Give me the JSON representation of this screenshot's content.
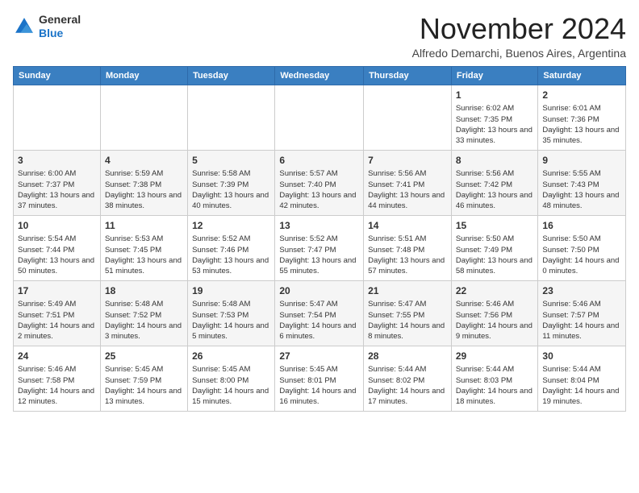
{
  "logo": {
    "general": "General",
    "blue": "Blue"
  },
  "header": {
    "month_title": "November 2024",
    "subtitle": "Alfredo Demarchi, Buenos Aires, Argentina"
  },
  "weekdays": [
    "Sunday",
    "Monday",
    "Tuesday",
    "Wednesday",
    "Thursday",
    "Friday",
    "Saturday"
  ],
  "weeks": [
    [
      {
        "day": "",
        "info": ""
      },
      {
        "day": "",
        "info": ""
      },
      {
        "day": "",
        "info": ""
      },
      {
        "day": "",
        "info": ""
      },
      {
        "day": "",
        "info": ""
      },
      {
        "day": "1",
        "info": "Sunrise: 6:02 AM\nSunset: 7:35 PM\nDaylight: 13 hours and 33 minutes."
      },
      {
        "day": "2",
        "info": "Sunrise: 6:01 AM\nSunset: 7:36 PM\nDaylight: 13 hours and 35 minutes."
      }
    ],
    [
      {
        "day": "3",
        "info": "Sunrise: 6:00 AM\nSunset: 7:37 PM\nDaylight: 13 hours and 37 minutes."
      },
      {
        "day": "4",
        "info": "Sunrise: 5:59 AM\nSunset: 7:38 PM\nDaylight: 13 hours and 38 minutes."
      },
      {
        "day": "5",
        "info": "Sunrise: 5:58 AM\nSunset: 7:39 PM\nDaylight: 13 hours and 40 minutes."
      },
      {
        "day": "6",
        "info": "Sunrise: 5:57 AM\nSunset: 7:40 PM\nDaylight: 13 hours and 42 minutes."
      },
      {
        "day": "7",
        "info": "Sunrise: 5:56 AM\nSunset: 7:41 PM\nDaylight: 13 hours and 44 minutes."
      },
      {
        "day": "8",
        "info": "Sunrise: 5:56 AM\nSunset: 7:42 PM\nDaylight: 13 hours and 46 minutes."
      },
      {
        "day": "9",
        "info": "Sunrise: 5:55 AM\nSunset: 7:43 PM\nDaylight: 13 hours and 48 minutes."
      }
    ],
    [
      {
        "day": "10",
        "info": "Sunrise: 5:54 AM\nSunset: 7:44 PM\nDaylight: 13 hours and 50 minutes."
      },
      {
        "day": "11",
        "info": "Sunrise: 5:53 AM\nSunset: 7:45 PM\nDaylight: 13 hours and 51 minutes."
      },
      {
        "day": "12",
        "info": "Sunrise: 5:52 AM\nSunset: 7:46 PM\nDaylight: 13 hours and 53 minutes."
      },
      {
        "day": "13",
        "info": "Sunrise: 5:52 AM\nSunset: 7:47 PM\nDaylight: 13 hours and 55 minutes."
      },
      {
        "day": "14",
        "info": "Sunrise: 5:51 AM\nSunset: 7:48 PM\nDaylight: 13 hours and 57 minutes."
      },
      {
        "day": "15",
        "info": "Sunrise: 5:50 AM\nSunset: 7:49 PM\nDaylight: 13 hours and 58 minutes."
      },
      {
        "day": "16",
        "info": "Sunrise: 5:50 AM\nSunset: 7:50 PM\nDaylight: 14 hours and 0 minutes."
      }
    ],
    [
      {
        "day": "17",
        "info": "Sunrise: 5:49 AM\nSunset: 7:51 PM\nDaylight: 14 hours and 2 minutes."
      },
      {
        "day": "18",
        "info": "Sunrise: 5:48 AM\nSunset: 7:52 PM\nDaylight: 14 hours and 3 minutes."
      },
      {
        "day": "19",
        "info": "Sunrise: 5:48 AM\nSunset: 7:53 PM\nDaylight: 14 hours and 5 minutes."
      },
      {
        "day": "20",
        "info": "Sunrise: 5:47 AM\nSunset: 7:54 PM\nDaylight: 14 hours and 6 minutes."
      },
      {
        "day": "21",
        "info": "Sunrise: 5:47 AM\nSunset: 7:55 PM\nDaylight: 14 hours and 8 minutes."
      },
      {
        "day": "22",
        "info": "Sunrise: 5:46 AM\nSunset: 7:56 PM\nDaylight: 14 hours and 9 minutes."
      },
      {
        "day": "23",
        "info": "Sunrise: 5:46 AM\nSunset: 7:57 PM\nDaylight: 14 hours and 11 minutes."
      }
    ],
    [
      {
        "day": "24",
        "info": "Sunrise: 5:46 AM\nSunset: 7:58 PM\nDaylight: 14 hours and 12 minutes."
      },
      {
        "day": "25",
        "info": "Sunrise: 5:45 AM\nSunset: 7:59 PM\nDaylight: 14 hours and 13 minutes."
      },
      {
        "day": "26",
        "info": "Sunrise: 5:45 AM\nSunset: 8:00 PM\nDaylight: 14 hours and 15 minutes."
      },
      {
        "day": "27",
        "info": "Sunrise: 5:45 AM\nSunset: 8:01 PM\nDaylight: 14 hours and 16 minutes."
      },
      {
        "day": "28",
        "info": "Sunrise: 5:44 AM\nSunset: 8:02 PM\nDaylight: 14 hours and 17 minutes."
      },
      {
        "day": "29",
        "info": "Sunrise: 5:44 AM\nSunset: 8:03 PM\nDaylight: 14 hours and 18 minutes."
      },
      {
        "day": "30",
        "info": "Sunrise: 5:44 AM\nSunset: 8:04 PM\nDaylight: 14 hours and 19 minutes."
      }
    ]
  ]
}
